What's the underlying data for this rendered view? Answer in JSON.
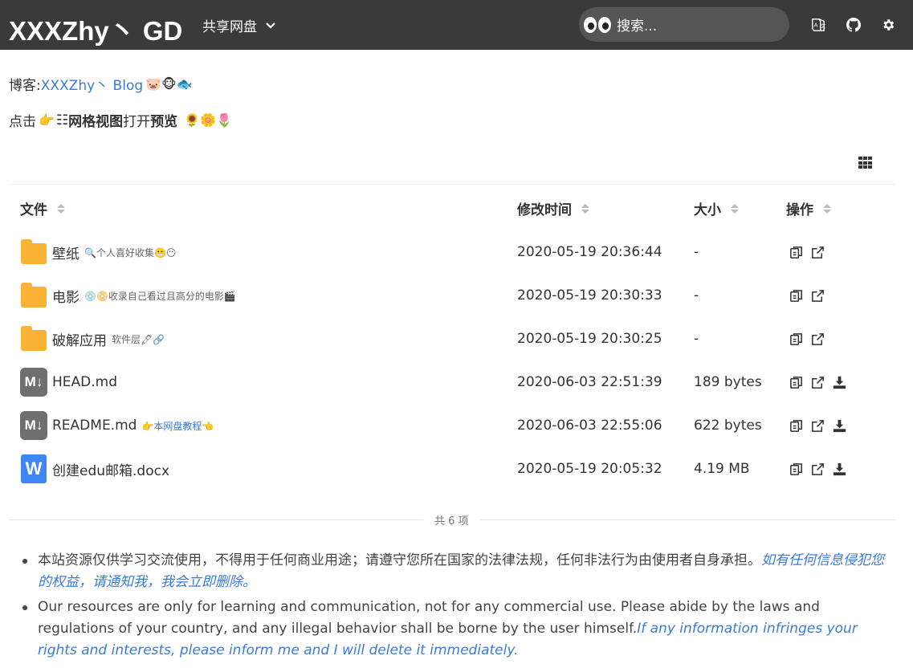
{
  "header": {
    "logo": "XXXZhy丶 GD",
    "drive_name": "共享网盘",
    "search_placeholder": "搜索..."
  },
  "intro": {
    "blog_prefix": "博客:",
    "blog_link": "XXXZhy丶 Blog",
    "blog_emoji": "🐷🐵🐟",
    "tip_prefix": "点击",
    "tip_pointer": "👉",
    "tip_grid_view": "网格视图",
    "tip_middle": "打开",
    "tip_preview": "预览",
    "tip_emoji": "🌻🌼🌷"
  },
  "table": {
    "columns": [
      "文件",
      "修改时间",
      "大小",
      "操作"
    ],
    "rows": [
      {
        "name": "壁纸",
        "type": "folder",
        "note": "🔍个人喜好收集😬😶",
        "note_style": "gray",
        "modified": "2020-05-19 20:36:44",
        "size": "-",
        "download": false
      },
      {
        "name": "电影",
        "type": "folder",
        "note": "💿📀收录自己看过且高分的电影🎬",
        "note_style": "gray",
        "modified": "2020-05-19 20:30:33",
        "size": "-",
        "download": false
      },
      {
        "name": "破解应用",
        "type": "folder",
        "note": "软件层🖊🔗",
        "note_style": "gray",
        "modified": "2020-05-19 20:30:25",
        "size": "-",
        "download": false
      },
      {
        "name": "HEAD.md",
        "type": "markdown",
        "note": "",
        "note_style": "gray",
        "modified": "2020-06-03 22:51:39",
        "size": "189 bytes",
        "download": true
      },
      {
        "name": "README.md",
        "type": "markdown",
        "note": "👉本网盘教程👈",
        "note_style": "link",
        "modified": "2020-06-03 22:55:06",
        "size": "622 bytes",
        "download": true
      },
      {
        "name": "创建edu邮箱.docx",
        "type": "word",
        "note": "",
        "note_style": "gray",
        "modified": "2020-05-19 20:05:32",
        "size": "4.19 MB",
        "download": true
      }
    ],
    "count_label": "共 6 项"
  },
  "footer": {
    "zh_text": "本站资源仅供学习交流使用，不得用于任何商业用途；请遵守您所在国家的法律法规，任何非法行为由使用者自身承担。",
    "zh_italic": "如有任何信息侵犯您的权益，请通知我，我会立即删除。",
    "en_text": "Our resources are only for learning and communication, not for any commercial use. Please abide by the laws and regulations of your country, and any illegal behavior shall be borne by the user himself.",
    "en_italic": "If any information infringes your rights and interests, please inform me and I will delete it immediately."
  },
  "colors": {
    "header_bg": "#3a3a3a",
    "link": "#3a7bd5",
    "folder": "#f9b233",
    "word": "#3e86f5"
  },
  "icons": {
    "header": [
      "translate-icon",
      "github-icon",
      "gear-icon"
    ],
    "row_ops": [
      "copy-link-icon",
      "open-external-icon",
      "download-icon"
    ],
    "view_toggle": "grid-view-icon"
  }
}
